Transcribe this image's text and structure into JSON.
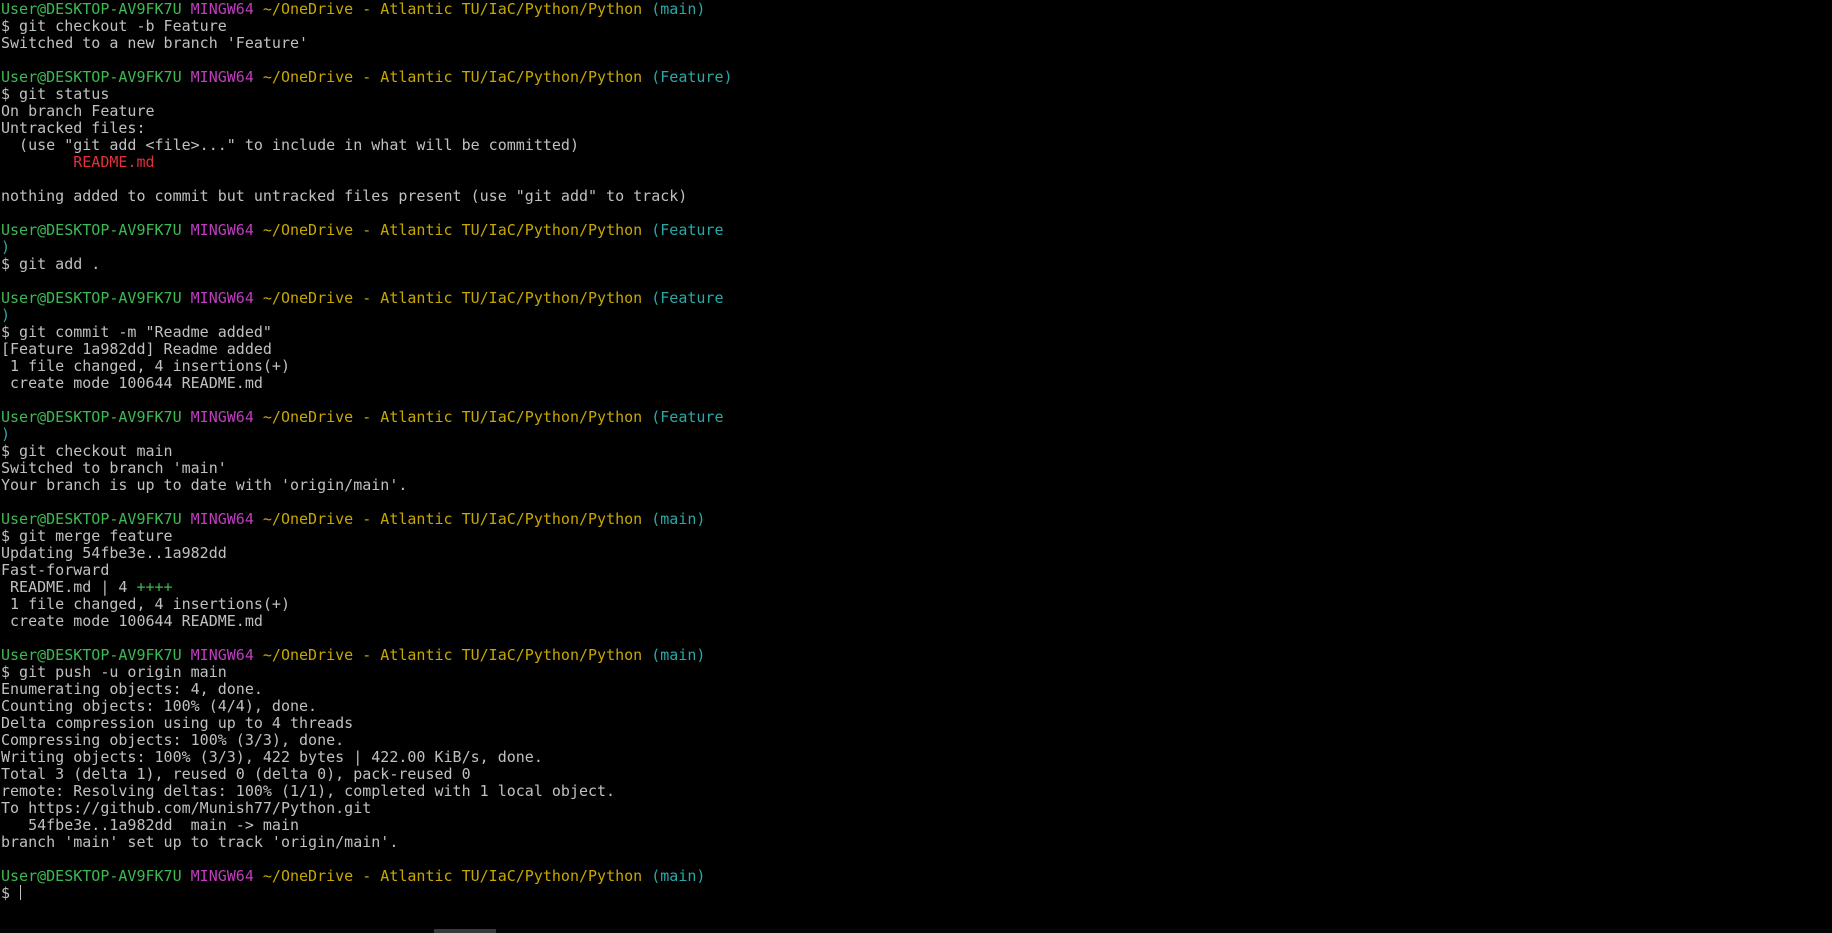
{
  "terminal": {
    "lines": [
      [
        {
          "t": "User@DESKTOP-AV9FK7U",
          "c": "u"
        },
        {
          "t": " "
        },
        {
          "t": "MINGW64",
          "c": "h"
        },
        {
          "t": " "
        },
        {
          "t": "~/OneDrive - Atlantic TU/IaC/Python/Python",
          "c": "p"
        },
        {
          "t": " "
        },
        {
          "t": "(main)",
          "c": "b"
        }
      ],
      [
        {
          "t": "$ git checkout -b Feature"
        }
      ],
      [
        {
          "t": "Switched to a new branch 'Feature'"
        }
      ],
      [],
      [
        {
          "t": "User@DESKTOP-AV9FK7U",
          "c": "u"
        },
        {
          "t": " "
        },
        {
          "t": "MINGW64",
          "c": "h"
        },
        {
          "t": " "
        },
        {
          "t": "~/OneDrive - Atlantic TU/IaC/Python/Python",
          "c": "p"
        },
        {
          "t": " "
        },
        {
          "t": "(Feature)",
          "c": "b"
        }
      ],
      [
        {
          "t": "$ git status"
        }
      ],
      [
        {
          "t": "On branch Feature"
        }
      ],
      [
        {
          "t": "Untracked files:"
        }
      ],
      [
        {
          "t": "  (use \"git add <file>...\" to include in what will be committed)"
        }
      ],
      [
        {
          "t": "        "
        },
        {
          "t": "README.md",
          "c": "r"
        }
      ],
      [],
      [
        {
          "t": "nothing added to commit but untracked files present (use \"git add\" to track)"
        }
      ],
      [],
      [
        {
          "t": "User@DESKTOP-AV9FK7U",
          "c": "u"
        },
        {
          "t": " "
        },
        {
          "t": "MINGW64",
          "c": "h"
        },
        {
          "t": " "
        },
        {
          "t": "~/OneDrive - Atlantic TU/IaC/Python/Python",
          "c": "p"
        },
        {
          "t": " "
        },
        {
          "t": "(Feature",
          "c": "b"
        }
      ],
      [
        {
          "t": ")",
          "c": "b"
        }
      ],
      [
        {
          "t": "$ git add ."
        }
      ],
      [],
      [
        {
          "t": "User@DESKTOP-AV9FK7U",
          "c": "u"
        },
        {
          "t": " "
        },
        {
          "t": "MINGW64",
          "c": "h"
        },
        {
          "t": " "
        },
        {
          "t": "~/OneDrive - Atlantic TU/IaC/Python/Python",
          "c": "p"
        },
        {
          "t": " "
        },
        {
          "t": "(Feature",
          "c": "b"
        }
      ],
      [
        {
          "t": ")",
          "c": "b"
        }
      ],
      [
        {
          "t": "$ git commit -m \"Readme added\""
        }
      ],
      [
        {
          "t": "[Feature 1a982dd] Readme added"
        }
      ],
      [
        {
          "t": " 1 file changed, 4 insertions(+)"
        }
      ],
      [
        {
          "t": " create mode 100644 README.md"
        }
      ],
      [],
      [
        {
          "t": "User@DESKTOP-AV9FK7U",
          "c": "u"
        },
        {
          "t": " "
        },
        {
          "t": "MINGW64",
          "c": "h"
        },
        {
          "t": " "
        },
        {
          "t": "~/OneDrive - Atlantic TU/IaC/Python/Python",
          "c": "p"
        },
        {
          "t": " "
        },
        {
          "t": "(Feature",
          "c": "b"
        }
      ],
      [
        {
          "t": ")",
          "c": "b"
        }
      ],
      [
        {
          "t": "$ git checkout main"
        }
      ],
      [
        {
          "t": "Switched to branch 'main'"
        }
      ],
      [
        {
          "t": "Your branch is up to date with 'origin/main'."
        }
      ],
      [],
      [
        {
          "t": "User@DESKTOP-AV9FK7U",
          "c": "u"
        },
        {
          "t": " "
        },
        {
          "t": "MINGW64",
          "c": "h"
        },
        {
          "t": " "
        },
        {
          "t": "~/OneDrive - Atlantic TU/IaC/Python/Python",
          "c": "p"
        },
        {
          "t": " "
        },
        {
          "t": "(main)",
          "c": "b"
        }
      ],
      [
        {
          "t": "$ git merge feature"
        }
      ],
      [
        {
          "t": "Updating 54fbe3e..1a982dd"
        }
      ],
      [
        {
          "t": "Fast-forward"
        }
      ],
      [
        {
          "t": " README.md | 4 "
        },
        {
          "t": "++++",
          "c": "g"
        }
      ],
      [
        {
          "t": " 1 file changed, 4 insertions(+)"
        }
      ],
      [
        {
          "t": " create mode 100644 README.md"
        }
      ],
      [],
      [
        {
          "t": "User@DESKTOP-AV9FK7U",
          "c": "u"
        },
        {
          "t": " "
        },
        {
          "t": "MINGW64",
          "c": "h"
        },
        {
          "t": " "
        },
        {
          "t": "~/OneDrive - Atlantic TU/IaC/Python/Python",
          "c": "p"
        },
        {
          "t": " "
        },
        {
          "t": "(main)",
          "c": "b"
        }
      ],
      [
        {
          "t": "$ git push -u origin main"
        }
      ],
      [
        {
          "t": "Enumerating objects: 4, done."
        }
      ],
      [
        {
          "t": "Counting objects: 100% (4/4), done."
        }
      ],
      [
        {
          "t": "Delta compression using up to 4 threads"
        }
      ],
      [
        {
          "t": "Compressing objects: 100% (3/3), done."
        }
      ],
      [
        {
          "t": "Writing objects: 100% (3/3), 422 bytes | 422.00 KiB/s, done."
        }
      ],
      [
        {
          "t": "Total 3 (delta 1), reused 0 (delta 0), pack-reused 0"
        }
      ],
      [
        {
          "t": "remote: Resolving deltas: 100% (1/1), completed with 1 local object."
        }
      ],
      [
        {
          "t": "To https://github.com/Munish77/Python.git"
        }
      ],
      [
        {
          "t": "   54fbe3e..1a982dd  main -> main"
        }
      ],
      [
        {
          "t": "branch 'main' set up to track 'origin/main'."
        }
      ],
      [],
      [
        {
          "t": "User@DESKTOP-AV9FK7U",
          "c": "u"
        },
        {
          "t": " "
        },
        {
          "t": "MINGW64",
          "c": "h"
        },
        {
          "t": " "
        },
        {
          "t": "~/OneDrive - Atlantic TU/IaC/Python/Python",
          "c": "p"
        },
        {
          "t": " "
        },
        {
          "t": "(main)",
          "c": "b"
        }
      ]
    ],
    "input_prompt": "$ ",
    "input_value": "",
    "colors": {
      "background": "#000000",
      "text": "#c0c0c0",
      "user_host": "#3cba54",
      "mingw": "#c03cc0",
      "path": "#c7a800",
      "branch": "#2aa8a8",
      "untracked_file": "#e0313a",
      "diff_plus": "#3cba54"
    }
  }
}
